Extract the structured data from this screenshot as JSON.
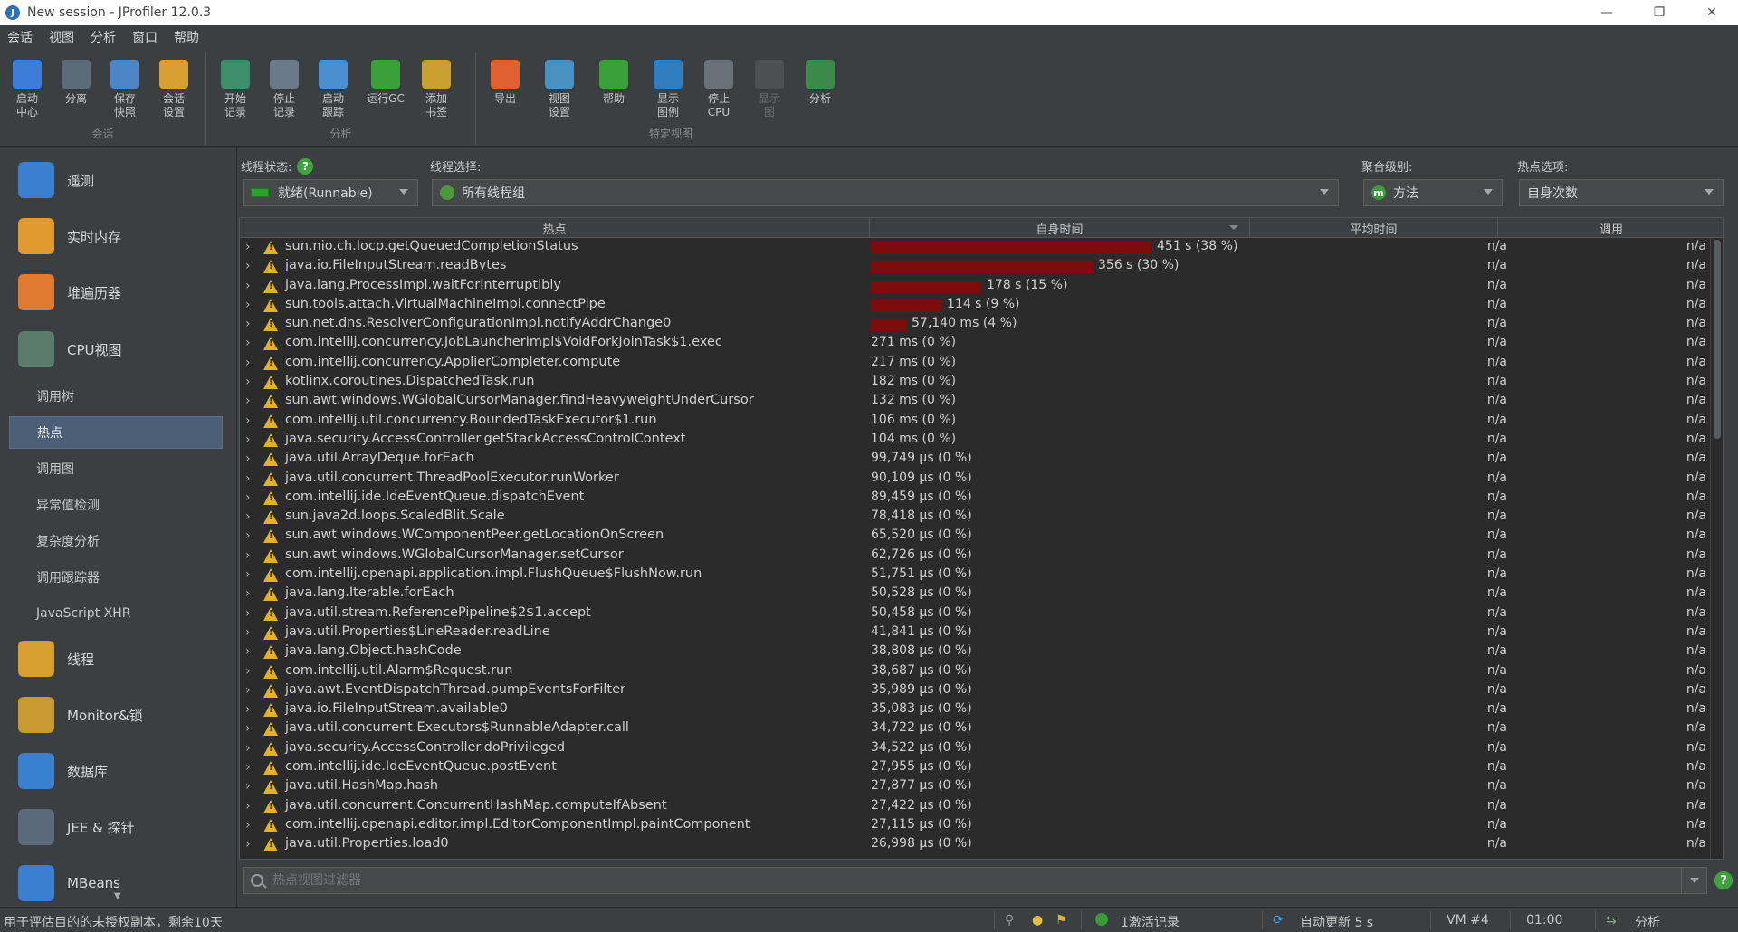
{
  "window": {
    "title": "New session - JProfiler 12.0.3",
    "controls": [
      "—",
      "❐",
      "✕"
    ]
  },
  "menu": [
    "会话",
    "视图",
    "分析",
    "窗口",
    "帮助"
  ],
  "toolbar": {
    "groups": [
      {
        "title": "会话",
        "buttons": [
          {
            "label": "启动\n中心",
            "icon": "start-center-icon",
            "color": "#3b7dd8"
          },
          {
            "label": "分离",
            "icon": "detach-icon",
            "color": "#5b6b7a"
          },
          {
            "label": "保存\n快照",
            "icon": "save-snapshot-icon",
            "color": "#4a86c8"
          },
          {
            "label": "会话\n设置",
            "icon": "session-settings-icon",
            "color": "#d8a030"
          }
        ]
      },
      {
        "title": "分析",
        "buttons": [
          {
            "label": "开始\n记录",
            "icon": "start-recording-icon",
            "color": "#3d8f6a"
          },
          {
            "label": "停止\n记录",
            "icon": "stop-recording-icon",
            "color": "#6a7a8a"
          },
          {
            "label": "启动\n跟踪",
            "icon": "start-tracking-icon",
            "color": "#4a90d0"
          },
          {
            "label": "运行GC",
            "icon": "run-gc-icon",
            "color": "#3aa03a"
          },
          {
            "label": "添加\n书签",
            "icon": "add-bookmark-icon",
            "color": "#c8a030"
          }
        ]
      },
      {
        "title": "特定视图",
        "buttons": [
          {
            "label": "导出",
            "icon": "export-icon",
            "color": "#e06030"
          },
          {
            "label": "视图\n设置",
            "icon": "view-settings-icon",
            "color": "#4a90c0"
          },
          {
            "label": "帮助",
            "icon": "help-icon",
            "color": "#3aa03a"
          },
          {
            "label": "显示\n图例",
            "icon": "show-legend-icon",
            "color": "#2f7fc0"
          },
          {
            "label": "停止\nCPU",
            "icon": "stop-cpu-icon",
            "color": "#6a7078"
          },
          {
            "label": "显示\n图",
            "icon": "show-graph-icon",
            "color": "#6a6a6a",
            "disabled": true
          },
          {
            "label": "分析",
            "icon": "analyze-icon",
            "color": "#3a8a4a"
          }
        ]
      }
    ]
  },
  "sidebar": {
    "items": [
      {
        "label": "遥测",
        "icon": "telemetry-icon",
        "color": "#3a7fd0"
      },
      {
        "label": "实时内存",
        "icon": "live-memory-icon",
        "color": "#e09a30"
      },
      {
        "label": "堆遍历器",
        "icon": "heap-walker-icon",
        "color": "#e07a30"
      },
      {
        "label": "CPU视图",
        "icon": "cpu-views-icon",
        "color": "#5a7a6a"
      }
    ],
    "sub_items": [
      "调用树",
      "热点",
      "调用图",
      "异常值检测",
      "复杂度分析",
      "调用跟踪器",
      "JavaScript XHR"
    ],
    "active_sub": "热点",
    "items2": [
      {
        "label": "线程",
        "icon": "threads-icon",
        "color": "#d8a030"
      },
      {
        "label": "Monitor&锁",
        "icon": "monitor-lock-icon",
        "color": "#c89a30"
      },
      {
        "label": "数据库",
        "icon": "database-icon",
        "color": "#3a80d0"
      },
      {
        "label": "JEE & 探针",
        "icon": "jee-probes-icon",
        "color": "#5a6a7a"
      },
      {
        "label": "MBeans",
        "icon": "mbeans-icon",
        "color": "#3a7fd0"
      }
    ]
  },
  "filters": {
    "thread_status_label": "线程状态:",
    "thread_status_value": "就绪(Runnable)",
    "thread_select_label": "线程选择:",
    "thread_select_value": "所有线程组",
    "aggregation_label": "聚合级别:",
    "aggregation_value": "方法",
    "hotspot_label": "热点选项:",
    "hotspot_value": "自身次数"
  },
  "table": {
    "headers": [
      "热点",
      "自身时间",
      "平均时间",
      "调用"
    ],
    "rows": [
      {
        "name": "sun.nio.ch.Iocp.getQueuedCompletionStatus",
        "time": "451 s (38 %)",
        "pct": 38,
        "avg": "n/a",
        "calls": "n/a"
      },
      {
        "name": "java.io.FileInputStream.readBytes",
        "time": "356 s (30 %)",
        "pct": 30,
        "avg": "n/a",
        "calls": "n/a"
      },
      {
        "name": "java.lang.ProcessImpl.waitForInterruptibly",
        "time": "178 s (15 %)",
        "pct": 15,
        "avg": "n/a",
        "calls": "n/a"
      },
      {
        "name": "sun.tools.attach.VirtualMachineImpl.connectPipe",
        "time": "114 s (9 %)",
        "pct": 9.6,
        "avg": "n/a",
        "calls": "n/a"
      },
      {
        "name": "sun.net.dns.ResolverConfigurationImpl.notifyAddrChange0",
        "time": "57,140 ms (4 %)",
        "pct": 4.8,
        "avg": "n/a",
        "calls": "n/a"
      },
      {
        "name": "com.intellij.concurrency.JobLauncherImpl$VoidForkJoinTask$1.exec",
        "time": "271 ms (0 %)",
        "pct": 0,
        "avg": "n/a",
        "calls": "n/a"
      },
      {
        "name": "com.intellij.concurrency.ApplierCompleter.compute",
        "time": "217 ms (0 %)",
        "pct": 0,
        "avg": "n/a",
        "calls": "n/a"
      },
      {
        "name": "kotlinx.coroutines.DispatchedTask.run",
        "time": "182 ms (0 %)",
        "pct": 0,
        "avg": "n/a",
        "calls": "n/a"
      },
      {
        "name": "sun.awt.windows.WGlobalCursorManager.findHeavyweightUnderCursor",
        "time": "132 ms (0 %)",
        "pct": 0,
        "avg": "n/a",
        "calls": "n/a"
      },
      {
        "name": "com.intellij.util.concurrency.BoundedTaskExecutor$1.run",
        "time": "106 ms (0 %)",
        "pct": 0,
        "avg": "n/a",
        "calls": "n/a"
      },
      {
        "name": "java.security.AccessController.getStackAccessControlContext",
        "time": "104 ms (0 %)",
        "pct": 0,
        "avg": "n/a",
        "calls": "n/a"
      },
      {
        "name": "java.util.ArrayDeque.forEach",
        "time": "99,749 µs (0 %)",
        "pct": 0,
        "avg": "n/a",
        "calls": "n/a"
      },
      {
        "name": "java.util.concurrent.ThreadPoolExecutor.runWorker",
        "time": "90,109 µs (0 %)",
        "pct": 0,
        "avg": "n/a",
        "calls": "n/a"
      },
      {
        "name": "com.intellij.ide.IdeEventQueue.dispatchEvent",
        "time": "89,459 µs (0 %)",
        "pct": 0,
        "avg": "n/a",
        "calls": "n/a"
      },
      {
        "name": "sun.java2d.loops.ScaledBlit.Scale",
        "time": "78,418 µs (0 %)",
        "pct": 0,
        "avg": "n/a",
        "calls": "n/a"
      },
      {
        "name": "sun.awt.windows.WComponentPeer.getLocationOnScreen",
        "time": "65,520 µs (0 %)",
        "pct": 0,
        "avg": "n/a",
        "calls": "n/a"
      },
      {
        "name": "sun.awt.windows.WGlobalCursorManager.setCursor",
        "time": "62,726 µs (0 %)",
        "pct": 0,
        "avg": "n/a",
        "calls": "n/a"
      },
      {
        "name": "com.intellij.openapi.application.impl.FlushQueue$FlushNow.run",
        "time": "51,751 µs (0 %)",
        "pct": 0,
        "avg": "n/a",
        "calls": "n/a"
      },
      {
        "name": "java.lang.Iterable.forEach",
        "time": "50,528 µs (0 %)",
        "pct": 0,
        "avg": "n/a",
        "calls": "n/a"
      },
      {
        "name": "java.util.stream.ReferencePipeline$2$1.accept",
        "time": "50,458 µs (0 %)",
        "pct": 0,
        "avg": "n/a",
        "calls": "n/a"
      },
      {
        "name": "java.util.Properties$LineReader.readLine",
        "time": "41,841 µs (0 %)",
        "pct": 0,
        "avg": "n/a",
        "calls": "n/a"
      },
      {
        "name": "java.lang.Object.hashCode",
        "time": "38,808 µs (0 %)",
        "pct": 0,
        "avg": "n/a",
        "calls": "n/a"
      },
      {
        "name": "com.intellij.util.Alarm$Request.run",
        "time": "38,687 µs (0 %)",
        "pct": 0,
        "avg": "n/a",
        "calls": "n/a"
      },
      {
        "name": "java.awt.EventDispatchThread.pumpEventsForFilter",
        "time": "35,989 µs (0 %)",
        "pct": 0,
        "avg": "n/a",
        "calls": "n/a"
      },
      {
        "name": "java.io.FileInputStream.available0",
        "time": "35,083 µs (0 %)",
        "pct": 0,
        "avg": "n/a",
        "calls": "n/a"
      },
      {
        "name": "java.util.concurrent.Executors$RunnableAdapter.call",
        "time": "34,722 µs (0 %)",
        "pct": 0,
        "avg": "n/a",
        "calls": "n/a"
      },
      {
        "name": "java.security.AccessController.doPrivileged",
        "time": "34,522 µs (0 %)",
        "pct": 0,
        "avg": "n/a",
        "calls": "n/a"
      },
      {
        "name": "com.intellij.ide.IdeEventQueue.postEvent",
        "time": "27,955 µs (0 %)",
        "pct": 0,
        "avg": "n/a",
        "calls": "n/a"
      },
      {
        "name": "java.util.HashMap.hash",
        "time": "27,877 µs (0 %)",
        "pct": 0,
        "avg": "n/a",
        "calls": "n/a"
      },
      {
        "name": "java.util.concurrent.ConcurrentHashMap.computeIfAbsent",
        "time": "27,422 µs (0 %)",
        "pct": 0,
        "avg": "n/a",
        "calls": "n/a"
      },
      {
        "name": "com.intellij.openapi.editor.impl.EditorComponentImpl.paintComponent",
        "time": "27,115 µs (0 %)",
        "pct": 0,
        "avg": "n/a",
        "calls": "n/a"
      },
      {
        "name": "java.util.Properties.load0",
        "time": "26,998 µs (0 %)",
        "pct": 0,
        "avg": "n/a",
        "calls": "n/a"
      }
    ]
  },
  "filter_bar": {
    "placeholder": "热点视图过滤器"
  },
  "status": {
    "license": "用于评估目的的未授权副本，剩余10天",
    "recordings": "1激活记录",
    "auto_update": "自动更新 5 s",
    "vm": "VM #4",
    "elapsed": "01:00",
    "mode": "分析"
  },
  "colors": {
    "bar": "#7d0b0b",
    "accent_green": "#3fa23f",
    "selection": "#4b5f77"
  }
}
